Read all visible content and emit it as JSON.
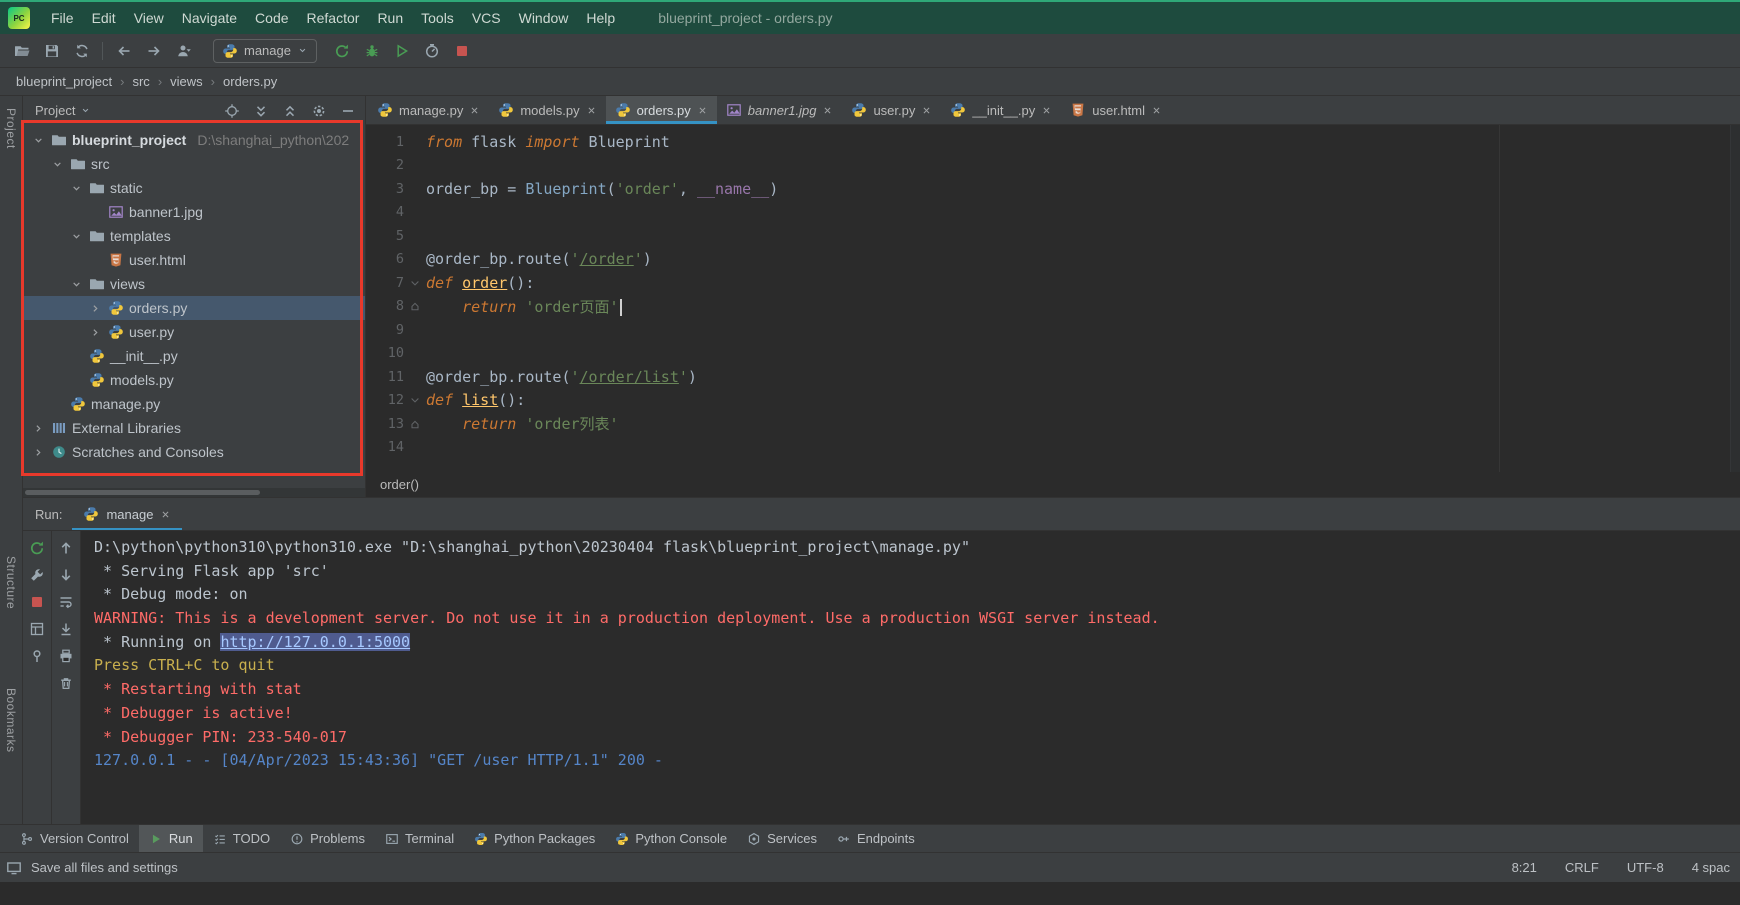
{
  "colors": {
    "titlebar_green": "#1e4b3e",
    "titlebar_strip": "#2fa878",
    "accent_blue": "#3592c4",
    "tree_selection": "#45586d",
    "run_green": "#499c54",
    "stop_red": "#c75450",
    "error_red": "#ff6b68",
    "warn_yellow": "#c9b04e",
    "info_blue": "#5585c8",
    "string_green": "#6a8759",
    "keyword_orange": "#cc7832",
    "function_yellow": "#ffc66b",
    "line_number": "#606366",
    "annotation_red": "#e8392b",
    "link_bg": "#4f5b8f",
    "link_text": "#a6c8ff"
  },
  "window": {
    "logo": "PC",
    "title": "blueprint_project - orders.py",
    "menus": [
      "File",
      "Edit",
      "View",
      "Navigate",
      "Code",
      "Refactor",
      "Run",
      "Tools",
      "VCS",
      "Window",
      "Help"
    ]
  },
  "toolbar": {
    "group1": [
      "open-icon",
      "save-icon",
      "sync-icon"
    ],
    "group2": [
      "back-icon",
      "forward-icon",
      "user-icon"
    ],
    "run_config": {
      "label": "manage",
      "icon": "python-icon"
    },
    "group3": [
      "rerun-icon",
      "debug-icon",
      "coverage-icon",
      "profile-icon",
      "stop-icon"
    ]
  },
  "breadcrumbs": [
    "blueprint_project",
    "src",
    "views",
    "orders.py"
  ],
  "left_stripe": [
    "Project",
    "Structure",
    "Bookmarks"
  ],
  "project_panel": {
    "title": "Project",
    "header_icons": [
      "select-opened-file-icon",
      "expand-all-icon",
      "collapse-all-icon",
      "gear-icon",
      "hide-icon"
    ],
    "tree": [
      {
        "label": "blueprint_project",
        "hint": "D:\\shanghai_python\\202",
        "icon": "folder-icon",
        "indent": 0,
        "chevron": "v",
        "bold": true
      },
      {
        "label": "src",
        "icon": "folder-icon",
        "indent": 1,
        "chevron": "v"
      },
      {
        "label": "static",
        "icon": "folder-icon",
        "indent": 2,
        "chevron": "v"
      },
      {
        "label": "banner1.jpg",
        "icon": "image-icon",
        "indent": 3
      },
      {
        "label": "templates",
        "icon": "folder-icon",
        "indent": 2,
        "chevron": "v"
      },
      {
        "label": "user.html",
        "icon": "html-icon",
        "indent": 3
      },
      {
        "label": "views",
        "icon": "folder-icon",
        "indent": 2,
        "chevron": "v"
      },
      {
        "label": "orders.py",
        "icon": "python-icon",
        "indent": 3,
        "chevron": ">",
        "selected": true
      },
      {
        "label": "user.py",
        "icon": "python-icon",
        "indent": 3,
        "chevron": ">"
      },
      {
        "label": "__init__.py",
        "icon": "python-icon",
        "indent": 2
      },
      {
        "label": "models.py",
        "icon": "python-icon",
        "indent": 2
      },
      {
        "label": "manage.py",
        "icon": "python-icon",
        "indent": 1
      },
      {
        "label": "External Libraries",
        "icon": "libraries-icon",
        "indent": 0,
        "chevron": ">"
      },
      {
        "label": "Scratches and Consoles",
        "icon": "scratches-icon",
        "indent": 0,
        "chevron": ">"
      }
    ]
  },
  "editor": {
    "tabs": [
      {
        "label": "manage.py",
        "icon": "python-icon"
      },
      {
        "label": "models.py",
        "icon": "python-icon"
      },
      {
        "label": "orders.py",
        "icon": "python-icon",
        "active": true
      },
      {
        "label": "banner1.jpg",
        "icon": "image-icon",
        "italic": true
      },
      {
        "label": "user.py",
        "icon": "python-icon"
      },
      {
        "label": "__init__.py",
        "icon": "python-icon"
      },
      {
        "label": "user.html",
        "icon": "html-icon"
      }
    ],
    "breadcrumb": "order()",
    "code": [
      {
        "n": 1,
        "segs": [
          [
            "kw",
            "from"
          ],
          [
            "pl",
            " flask "
          ],
          [
            "kw",
            "import"
          ],
          [
            "pl",
            " Blueprint"
          ]
        ]
      },
      {
        "n": 2,
        "segs": []
      },
      {
        "n": 3,
        "segs": [
          [
            "pl",
            "order_bp = "
          ],
          [
            "cls",
            "Blueprint"
          ],
          [
            "pl",
            "("
          ],
          [
            "str",
            "'order'"
          ],
          [
            "pl",
            ", "
          ],
          [
            "du",
            "__name__"
          ],
          [
            "pl",
            ")"
          ]
        ]
      },
      {
        "n": 4,
        "segs": []
      },
      {
        "n": 5,
        "segs": []
      },
      {
        "n": 6,
        "segs": [
          [
            "pl",
            "@order_bp.route("
          ],
          [
            "str",
            "'"
          ],
          [
            "stru",
            "/order"
          ],
          [
            "str",
            "'"
          ],
          [
            "pl",
            ")"
          ]
        ]
      },
      {
        "n": 7,
        "marker": "fold-top",
        "segs": [
          [
            "kw",
            "def "
          ],
          [
            "fn",
            "order"
          ],
          [
            "pl",
            "():"
          ]
        ]
      },
      {
        "n": 8,
        "marker": "fold-bottom",
        "caret": true,
        "segs": [
          [
            "pl",
            "    "
          ],
          [
            "kw",
            "return "
          ],
          [
            "str",
            "'order页面'"
          ]
        ]
      },
      {
        "n": 9,
        "segs": []
      },
      {
        "n": 10,
        "segs": []
      },
      {
        "n": 11,
        "segs": [
          [
            "pl",
            "@order_bp.route("
          ],
          [
            "str",
            "'"
          ],
          [
            "stru",
            "/order/list"
          ],
          [
            "str",
            "'"
          ],
          [
            "pl",
            ")"
          ]
        ]
      },
      {
        "n": 12,
        "marker": "fold-top",
        "segs": [
          [
            "kw",
            "def "
          ],
          [
            "fn",
            "list"
          ],
          [
            "pl",
            "():"
          ]
        ]
      },
      {
        "n": 13,
        "marker": "fold-bottom",
        "segs": [
          [
            "pl",
            "    "
          ],
          [
            "kw",
            "return "
          ],
          [
            "str",
            "'order列表'"
          ]
        ]
      },
      {
        "n": 14,
        "segs": []
      }
    ]
  },
  "run_panel": {
    "label": "Run:",
    "tab": {
      "label": "manage",
      "icon": "python-icon"
    },
    "toolbar_col1": [
      "rerun-icon",
      "wrench-icon",
      "stop-icon",
      "restore-layout-icon",
      "pin-icon"
    ],
    "toolbar_col2": [
      "up-icon",
      "down-icon",
      "soft-wrap-icon",
      "scroll-end-icon",
      "printer-icon",
      "clear-icon"
    ],
    "console": [
      {
        "c": "plain",
        "t": "D:\\python\\python310\\python310.exe \"D:\\shanghai_python\\20230404 flask\\blueprint_project\\manage.py\""
      },
      {
        "c": "plain",
        "t": " * Serving Flask app 'src'"
      },
      {
        "c": "plain",
        "t": " * Debug mode: on"
      },
      {
        "c": "error",
        "t": "WARNING: This is a development server. Do not use it in a production deployment. Use a production WSGI server instead."
      },
      {
        "c": "plain",
        "t": " * Running on ",
        "link": "http://127.0.0.1:5000"
      },
      {
        "c": "warn",
        "t": "Press CTRL+C to quit"
      },
      {
        "c": "error",
        "t": " * Restarting with stat"
      },
      {
        "c": "error",
        "t": " * Debugger is active!"
      },
      {
        "c": "error",
        "t": " * Debugger PIN: 233-540-017"
      },
      {
        "c": "info",
        "t": "127.0.0.1 - - [04/Apr/2023 15:43:36] \"GET /user HTTP/1.1\" 200 -"
      }
    ]
  },
  "bottom_bar": [
    {
      "label": "Version Control",
      "icon": "branch-icon"
    },
    {
      "label": "Run",
      "icon": "run-play-icon",
      "active": true
    },
    {
      "label": "TODO",
      "icon": "todo-icon"
    },
    {
      "label": "Problems",
      "icon": "problems-icon"
    },
    {
      "label": "Terminal",
      "icon": "terminal-icon"
    },
    {
      "label": "Python Packages",
      "icon": "python-icon"
    },
    {
      "label": "Python Console",
      "icon": "python-icon"
    },
    {
      "label": "Services",
      "icon": "services-icon"
    },
    {
      "label": "Endpoints",
      "icon": "endpoints-icon"
    }
  ],
  "status_bar": {
    "left": "Save all files and settings",
    "right": [
      "8:21",
      "CRLF",
      "UTF-8",
      "4 spac"
    ]
  }
}
